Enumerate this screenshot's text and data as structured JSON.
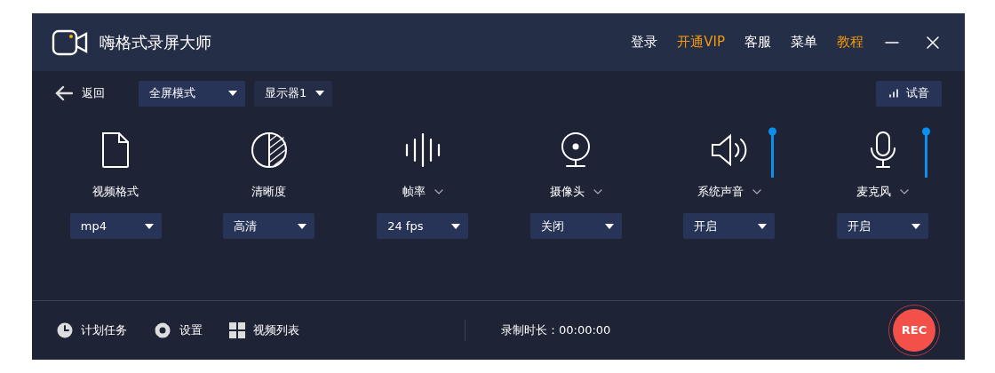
{
  "window": {
    "title": "嗨格式录屏大师"
  },
  "nav": [
    {
      "label": "登录",
      "highlight": false
    },
    {
      "label": "开通VIP",
      "highlight": true
    },
    {
      "label": "客服",
      "highlight": false
    },
    {
      "label": "菜单",
      "highlight": false
    },
    {
      "label": "教程",
      "highlight": true
    }
  ],
  "toolbar": {
    "back": "返回",
    "mode": "全屏模式",
    "display": "显示器1",
    "test_sound": "试音"
  },
  "settings": [
    {
      "kind": "file",
      "label": "视频格式",
      "menu": false,
      "value": "mp4"
    },
    {
      "kind": "clarity",
      "label": "清晰度",
      "menu": false,
      "value": "高清"
    },
    {
      "kind": "framerate",
      "label": "帧率",
      "menu": true,
      "value": "24 fps"
    },
    {
      "kind": "camera",
      "label": "摄像头",
      "menu": true,
      "value": "关闭"
    },
    {
      "kind": "speaker",
      "label": "系统声音",
      "menu": true,
      "value": "开启",
      "level": 1
    },
    {
      "kind": "microphone",
      "label": "麦克风",
      "menu": true,
      "value": "开启",
      "level": 1
    }
  ],
  "footer": {
    "items": [
      {
        "kind": "schedule",
        "label": "计划任务"
      },
      {
        "kind": "settings",
        "label": "设置"
      },
      {
        "kind": "list",
        "label": "视频列表"
      }
    ],
    "duration": "录制时长：00:00:00",
    "rec": "REC"
  }
}
